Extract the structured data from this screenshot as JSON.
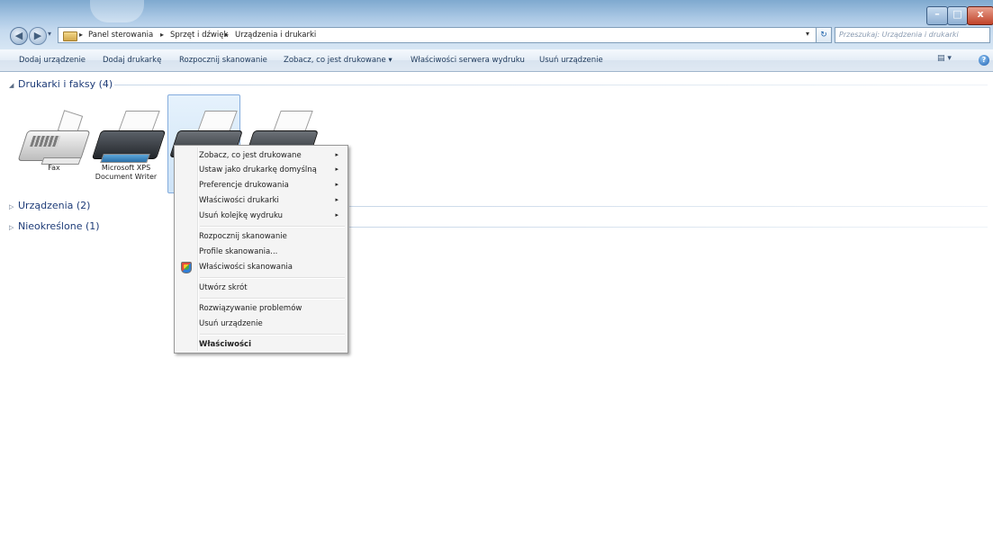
{
  "window": {
    "title": "Urządzenia i drukarki",
    "controls": {
      "minimize": "–",
      "maximize": "□",
      "close": "x"
    }
  },
  "address_bar": {
    "breadcrumbs": [
      "Panel sterowania",
      "Sprzęt i dźwięk",
      "Urządzenia i drukarki"
    ],
    "search_placeholder": "Przeszukaj: Urządzenia i drukarki"
  },
  "command_bar": {
    "items": [
      "Dodaj urządzenie",
      "Dodaj drukarkę",
      "Rozpocznij skanowanie",
      "Zobacz, co jest drukowane ▾",
      "Właściwości serwera wydruku",
      "Usuń urządzenie"
    ],
    "help": "?"
  },
  "groups": [
    {
      "label": "Drukarki i faksy (4)",
      "expanded": true
    },
    {
      "label": "Urządzenia (2)",
      "expanded": false
    },
    {
      "label": "Nieokreślone (1)",
      "expanded": false
    }
  ],
  "devices": [
    {
      "name": "Fax",
      "icon": "fax-icon"
    },
    {
      "name": "Microsoft XPS Document Writer",
      "icon": "printer-icon"
    },
    {
      "name": "",
      "icon": "printer-icon",
      "selected": true
    },
    {
      "name": "",
      "icon": "printer-icon"
    }
  ],
  "context_menu": {
    "items": [
      {
        "label": "Zobacz, co jest drukowane",
        "submenu": true
      },
      {
        "label": "Ustaw jako drukarkę domyślną",
        "submenu": true
      },
      {
        "label": "Preferencje drukowania",
        "submenu": true
      },
      {
        "label": "Właściwości drukarki",
        "submenu": true
      },
      {
        "label": "Usuń kolejkę wydruku",
        "submenu": true
      },
      {
        "label": "Rozpocznij skanowanie"
      },
      {
        "label": "Profile skanowania..."
      },
      {
        "label": "Właściwości skanowania",
        "icon": "shield-icon"
      },
      {
        "label": "Utwórz skrót"
      },
      {
        "label": "Rozwiązywanie problemów"
      },
      {
        "label": "Usuń urządzenie"
      },
      {
        "label": "Właściwości",
        "bold": true
      }
    ],
    "submenu_arrow": "▸"
  },
  "colors": {
    "accent": "#1e395b",
    "selection": "#cde3f7",
    "group_header": "#1e3c78"
  }
}
